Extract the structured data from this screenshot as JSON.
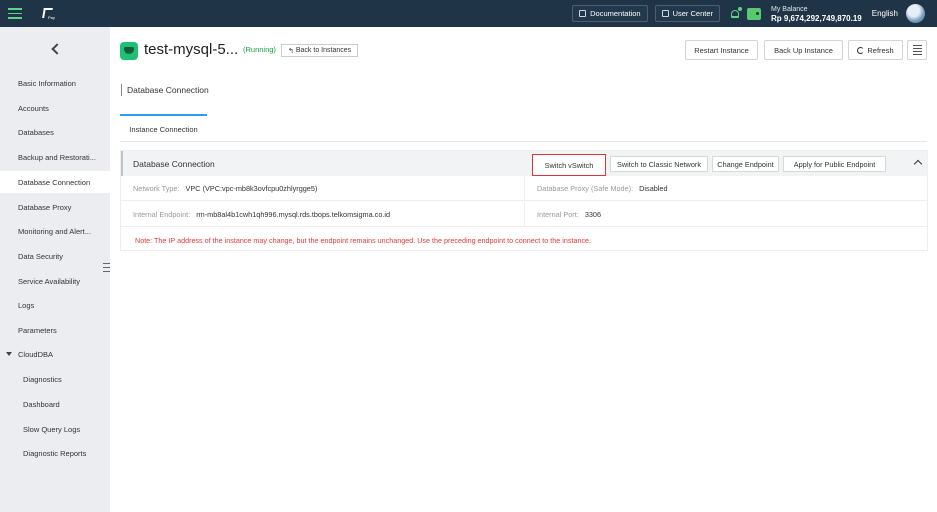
{
  "topbar": {
    "logo_text": "Pay",
    "documentation": "Documentation",
    "user_center": "User Center",
    "balance_label": "My Balance",
    "balance_value": "Rp 9,674,292,749,870.19",
    "language": "English"
  },
  "sidebar": {
    "items": [
      {
        "label": "Basic Information"
      },
      {
        "label": "Accounts"
      },
      {
        "label": "Databases"
      },
      {
        "label": "Backup and Restorati..."
      },
      {
        "label": "Database Connection"
      },
      {
        "label": "Database Proxy"
      },
      {
        "label": "Monitoring and Alert..."
      },
      {
        "label": "Data Security"
      },
      {
        "label": "Service Availability"
      },
      {
        "label": "Logs"
      },
      {
        "label": "Parameters"
      },
      {
        "label": "CloudDBA"
      },
      {
        "label": "Diagnostics"
      },
      {
        "label": "Dashboard"
      },
      {
        "label": "Slow Query Logs"
      },
      {
        "label": "Diagnostic Reports"
      }
    ]
  },
  "header": {
    "instance_name": "test-mysql-5...",
    "status": "(Running)",
    "back_label": "Back to Instances",
    "restart_label": "Restart Instance",
    "backup_label": "Back Up Instance",
    "refresh_label": "Refresh"
  },
  "section": {
    "title": "Database Connection",
    "tab": "Instance Connection"
  },
  "panel": {
    "title": "Database Connection",
    "buttons": {
      "switch_vswitch": "Switch vSwitch",
      "switch_classic": "Switch to Classic Network",
      "change_endpoint": "Change Endpoint",
      "apply_public": "Apply for Public Endpoint"
    },
    "network_type_key": "Network Type:",
    "network_type_value": "VPC  (VPC:vpc-mb8k3ovfcpu0zhlyrgge5)",
    "proxy_key": "Database Proxy (Safe Mode):",
    "proxy_value": "Disabled",
    "endpoint_key": "Internal Endpoint:",
    "endpoint_value": "rm-mb8al4b1cwh1qh996.mysql.rds.tbops.telkomsigma.co.id",
    "port_key": "Internal Port:",
    "port_value": "3306",
    "note": "Note: The IP address of the instance may change, but the endpoint remains unchanged. Use the preceding endpoint to connect to the instance."
  }
}
